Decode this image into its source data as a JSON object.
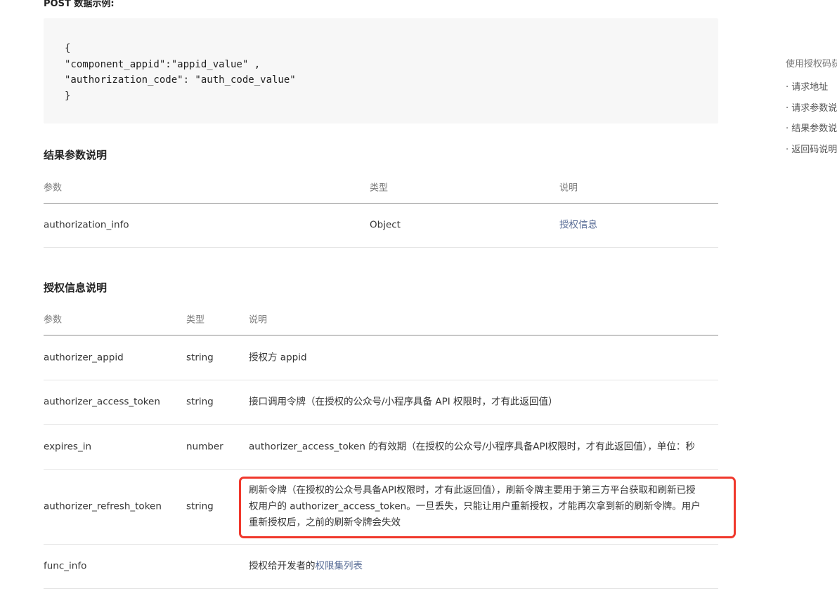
{
  "post_label": "POST 数据示例:",
  "code_lines": [
    "{",
    "\"component_appid\":\"appid_value\" ,",
    "\"authorization_code\": \"auth_code_value\"",
    "}"
  ],
  "result_section": {
    "title": "结果参数说明",
    "headers": [
      "参数",
      "类型",
      "说明"
    ],
    "rows": [
      {
        "param": "authorization_info",
        "type": "Object",
        "desc": "授权信息"
      }
    ]
  },
  "auth_section": {
    "title": "授权信息说明",
    "headers": [
      "参数",
      "类型",
      "说明"
    ],
    "rows": [
      {
        "param": "authorizer_appid",
        "type": "string",
        "desc": "授权方 appid"
      },
      {
        "param": "authorizer_access_token",
        "type": "string",
        "desc": "接口调用令牌（在授权的公众号/小程序具备 API 权限时，才有此返回值）"
      },
      {
        "param": "expires_in",
        "type": "number",
        "desc": "authorizer_access_token 的有效期（在授权的公众号/小程序具备API权限时，才有此返回值），单位：秒"
      },
      {
        "param": "authorizer_refresh_token",
        "type": "string",
        "desc_lines": [
          "刷新令牌（在授权的公众号具备API权限时，才有此返回值），刷新令牌主要用于第三方平台获取和刷新已授",
          "权用户的 authorizer_access_token。一旦丢失，只能让用户重新授权，才能再次拿到新的刷新令牌。用户",
          "重新授权后，之前的刷新令牌会失效"
        ]
      },
      {
        "param": "func_info",
        "type": "",
        "desc_prefix": "授权给开发者的",
        "desc_link": "权限集列表"
      }
    ]
  },
  "toc": {
    "title": "使用授权码获",
    "items": [
      "· 请求地址",
      "· 请求参数说",
      "· 结果参数说",
      "· 返回码说明"
    ]
  },
  "colors": {
    "link": "#576b95",
    "highlight": "#f0382c",
    "code_bg": "#f7f7f7"
  }
}
